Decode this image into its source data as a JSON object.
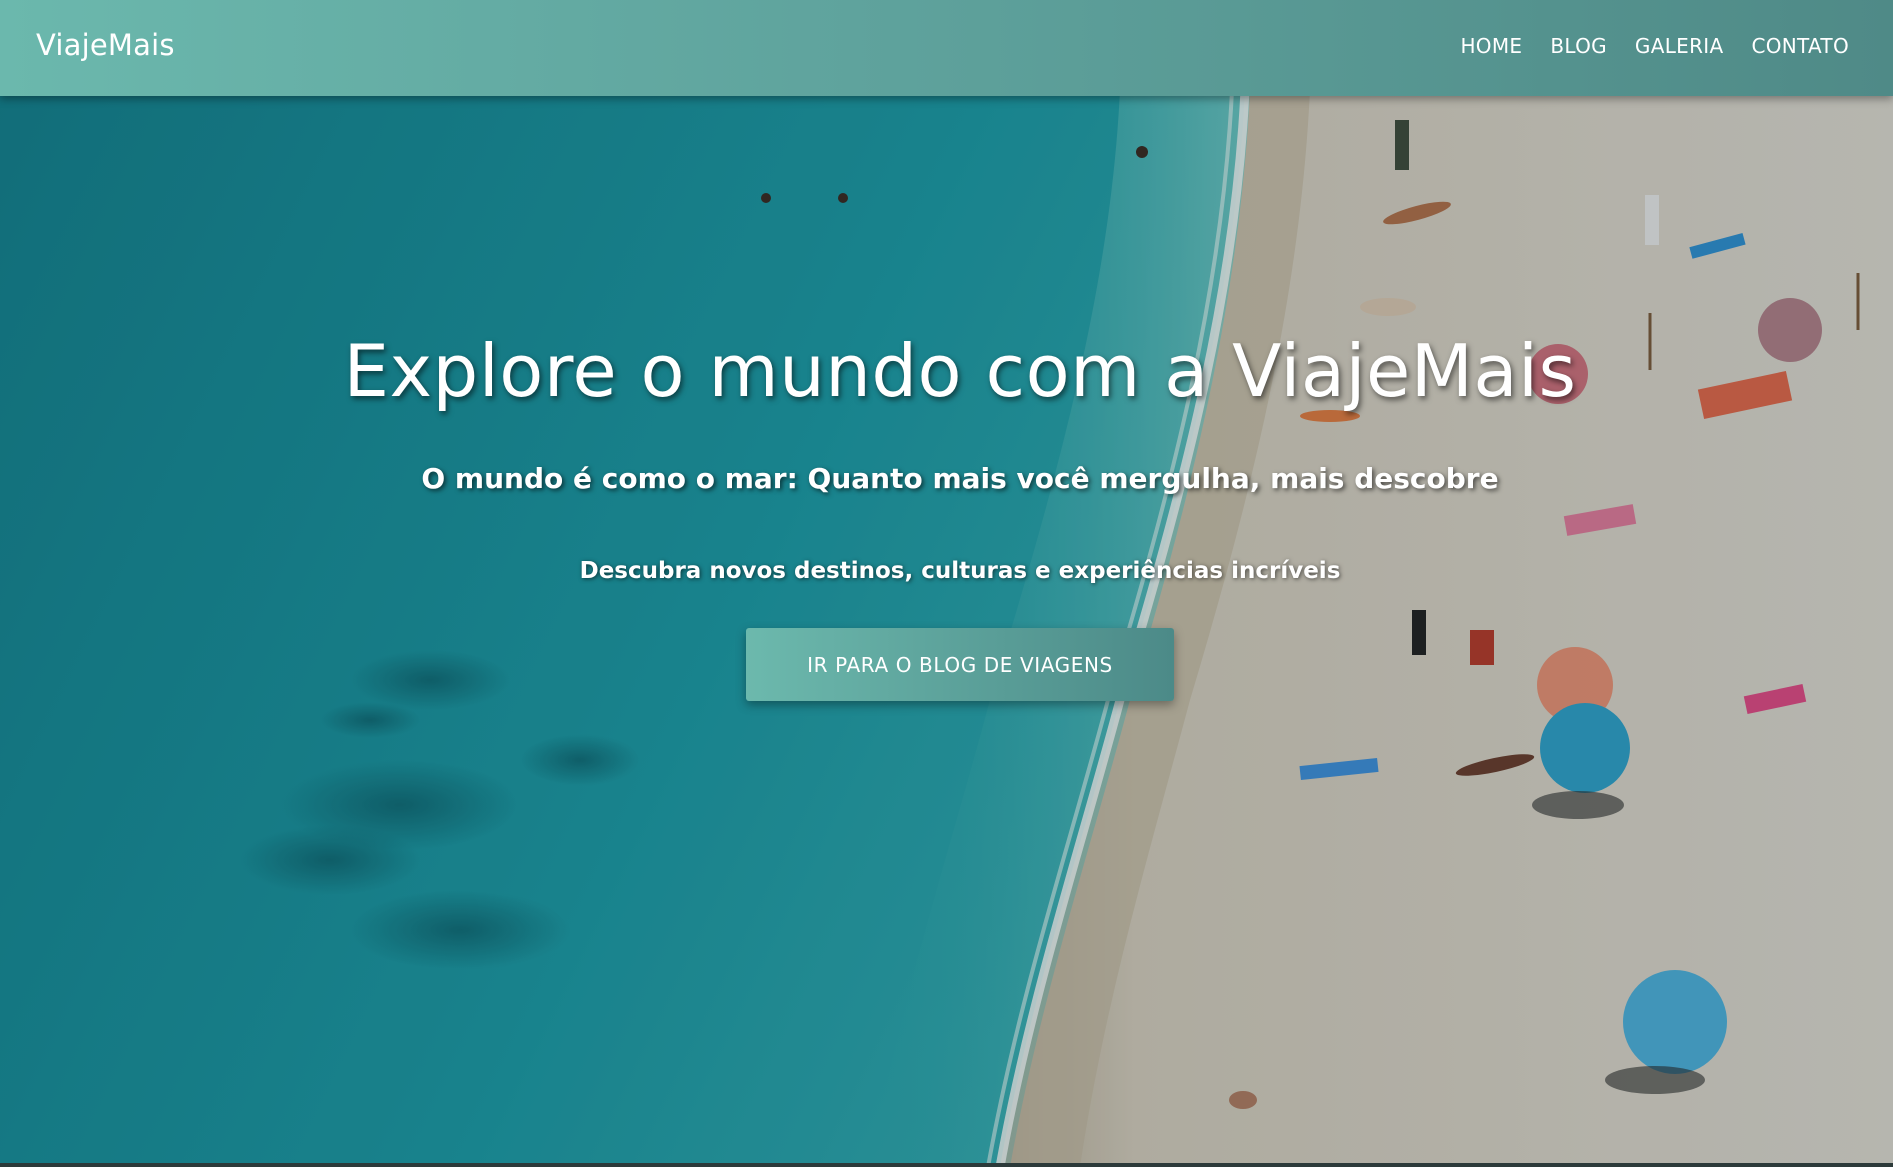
{
  "header": {
    "brand": "ViajeMais",
    "nav": [
      {
        "label": "HOME"
      },
      {
        "label": "BLOG"
      },
      {
        "label": "GALERIA"
      },
      {
        "label": "CONTATO"
      }
    ]
  },
  "hero": {
    "title": "Explore o mundo com a ViajeMais",
    "subtitle": "O mundo é como o mar: Quanto mais você mergulha, mais descobre",
    "text": "Descubra novos destinos, culturas e experiências incríveis",
    "cta_label": "IR PARA O BLOG DE VIAGENS"
  },
  "background": {
    "description_icon": "beach-aerial-photo",
    "colors": {
      "sea": "#1d9aa3",
      "sea_deep": "#137a86",
      "sand": "#d9d4c8",
      "header_start": "#6bb8ad",
      "header_end": "#4f8a87"
    }
  }
}
